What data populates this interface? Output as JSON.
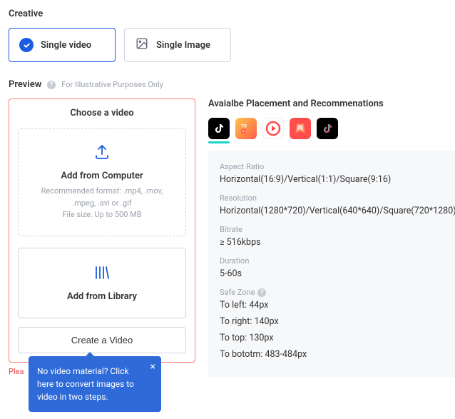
{
  "creative": {
    "section_label": "Creative",
    "options": {
      "single_video": "Single video",
      "single_image": "Single Image"
    }
  },
  "preview": {
    "label": "Preview",
    "note": "For Illustrative Purposes Only",
    "choose_title": "Choose a video",
    "add_computer": {
      "title": "Add from Computer",
      "hint_line1": "Recommended format: .mp4, .mov,",
      "hint_line2": ".mpeg, .avi or .gif",
      "hint_line3": "File size: Up to 500 MB"
    },
    "add_library": {
      "title": "Add from Library"
    },
    "create_btn": "Create a Video",
    "error_text": "Plea",
    "tooltip": {
      "text": "No video material? Click here to convert images to video in two steps.",
      "close": "×"
    }
  },
  "placements": {
    "title": "Avaialbe Placement and Recommenations",
    "apps": [
      "TikTok",
      "BuzzVideo",
      "Vigo",
      "Xigua",
      "TikTok"
    ]
  },
  "specs": {
    "aspect_ratio": {
      "label": "Aspect Ratio",
      "value": "Horizontal(16:9)/Vertical(1:1)/Square(9:16)"
    },
    "resolution": {
      "label": "Resolution",
      "value": "Horizontal(1280*720)/Vertical(640*640)/Square(720*1280)"
    },
    "bitrate": {
      "label": "Bitrate",
      "value": "≥ 516kbps"
    },
    "duration": {
      "label": "Duration",
      "value": "5-60s"
    },
    "safezone": {
      "label": "Safe Zone",
      "left": "To left: 44px",
      "right": "To right: 140px",
      "top": "To top: 130px",
      "bottom": "To bototm: 483-484px"
    }
  }
}
